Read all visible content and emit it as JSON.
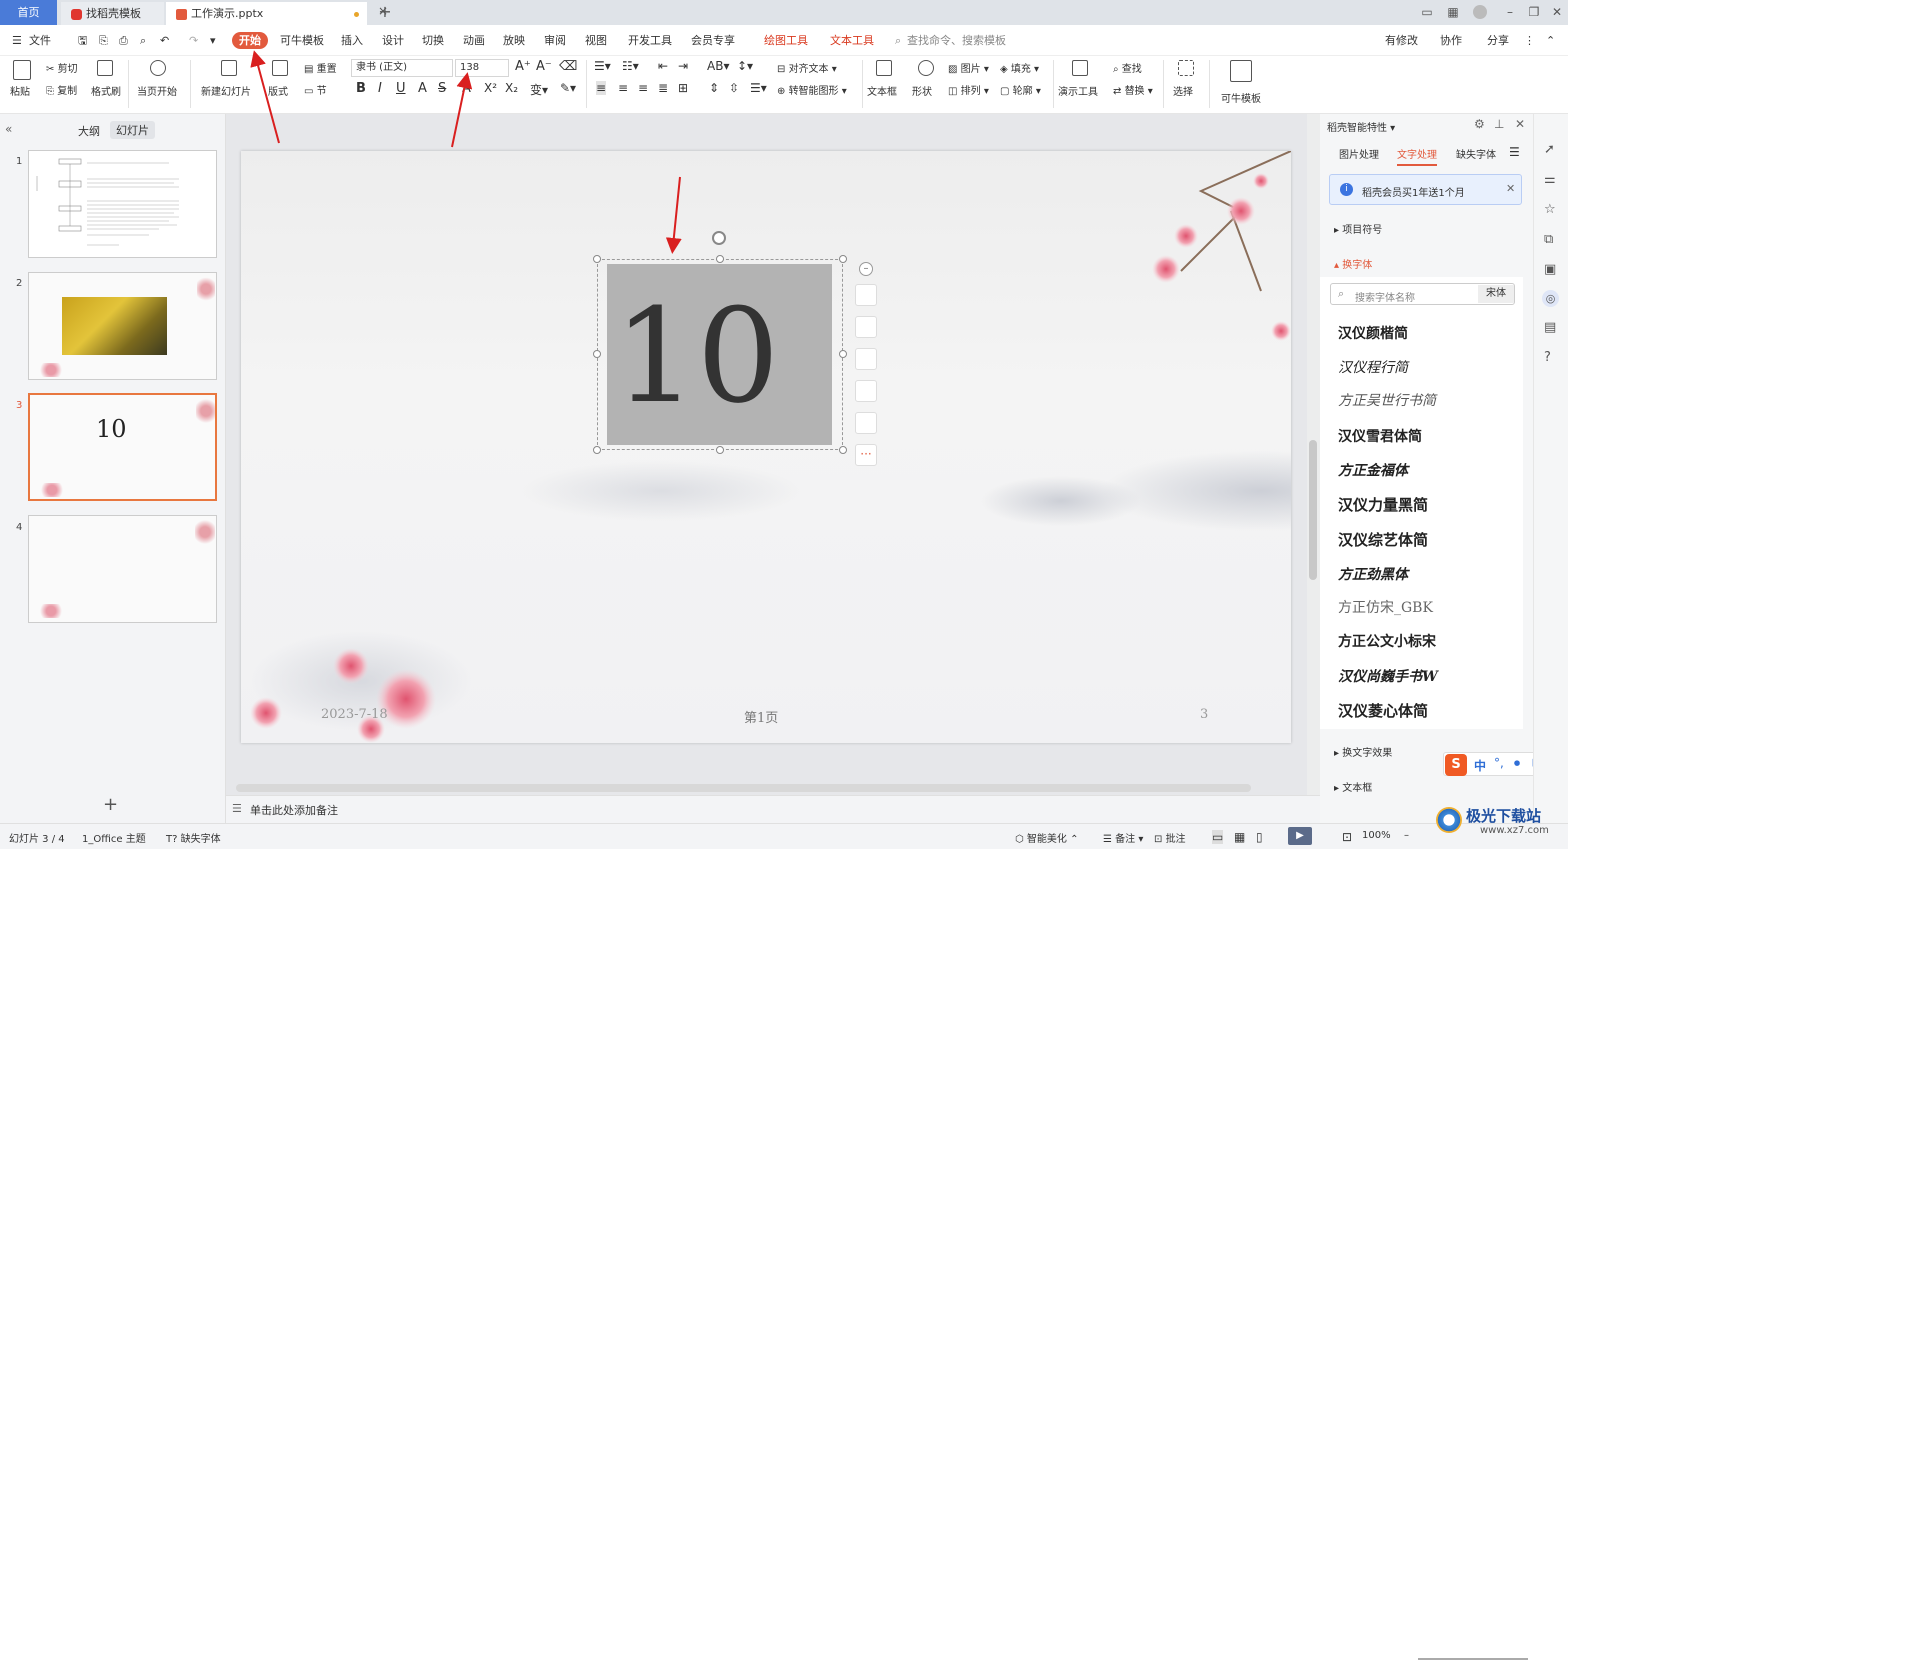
{
  "tabs": {
    "home": "首页",
    "find": "找稻壳模板",
    "doc": "工作演示.pptx"
  },
  "menu": {
    "file": "文件",
    "start": "开始",
    "keniu": "可牛模板",
    "insert": "插入",
    "design": "设计",
    "switch": "切换",
    "animation": "动画",
    "slideshow": "放映",
    "review": "审阅",
    "view": "视图",
    "devtools": "开发工具",
    "member": "会员专享",
    "drawing": "绘图工具",
    "texttool": "文本工具",
    "search_placeholder": "查找命令、搜索模板",
    "modified": "有修改",
    "collab": "协作",
    "share": "分享"
  },
  "ribbon": {
    "paste": "粘贴",
    "cut": "剪切",
    "copy": "复制",
    "format_painter": "格式刷",
    "from_current": "当页开始",
    "new_slide": "新建幻灯片",
    "layout": "版式",
    "reset": "重置",
    "section": "节",
    "font_name": "隶书 (正文)",
    "font_size": "138",
    "align_text": "对齐文本",
    "smartart": "转智能图形",
    "textbox": "文本框",
    "shape": "形状",
    "picture": "图片",
    "arrange": "排列",
    "fill": "填充",
    "outline": "轮廓",
    "present_tools": "演示工具",
    "find": "查找",
    "replace": "替换",
    "select": "选择",
    "keniu_template": "可牛模板"
  },
  "left": {
    "outline_tab": "大纲",
    "slides_tab": "幻灯片",
    "slides": [
      "1",
      "2",
      "3",
      "4"
    ],
    "thumb3_text": "10"
  },
  "slide": {
    "main_text": "10",
    "date": "2023-7-18",
    "page": "第1页",
    "number": "3"
  },
  "notes": {
    "placeholder": "单击此处添加备注"
  },
  "right": {
    "title": "稻壳智能特性",
    "tabs": [
      "图片处理",
      "文字处理",
      "缺失字体"
    ],
    "banner": "稻壳会员买1年送1个月",
    "bullets": "项目符号",
    "font_change": "换字体",
    "font_search_placeholder": "搜索字体名称",
    "font_current": "宋体",
    "fonts": [
      "汉仪颜楷简",
      "汉仪程行简",
      "方正吴世行书简",
      "汉仪雪君体简",
      "方正金福体",
      "汉仪力量黑简",
      "汉仪综艺体简",
      "方正劲黑体",
      "方正仿宋_GBK",
      "方正公文小标宋",
      "汉仪尚巍手书W",
      "汉仪菱心体简"
    ],
    "text_effect": "换文字效果",
    "textbox": "文本框",
    "ime": "中"
  },
  "status": {
    "slide": "幻灯片 3 / 4",
    "theme": "1_Office 主题",
    "missing_font": "缺失字体",
    "beautify": "智能美化",
    "notes": "备注",
    "comment": "批注",
    "zoom": "100%"
  },
  "watermark": {
    "text": "极光下载站",
    "url": "www.xz7.com"
  },
  "colors": {
    "accent": "#e25a3d",
    "brand_blue": "#4a7bd8",
    "arrow": "#d91f1f"
  }
}
